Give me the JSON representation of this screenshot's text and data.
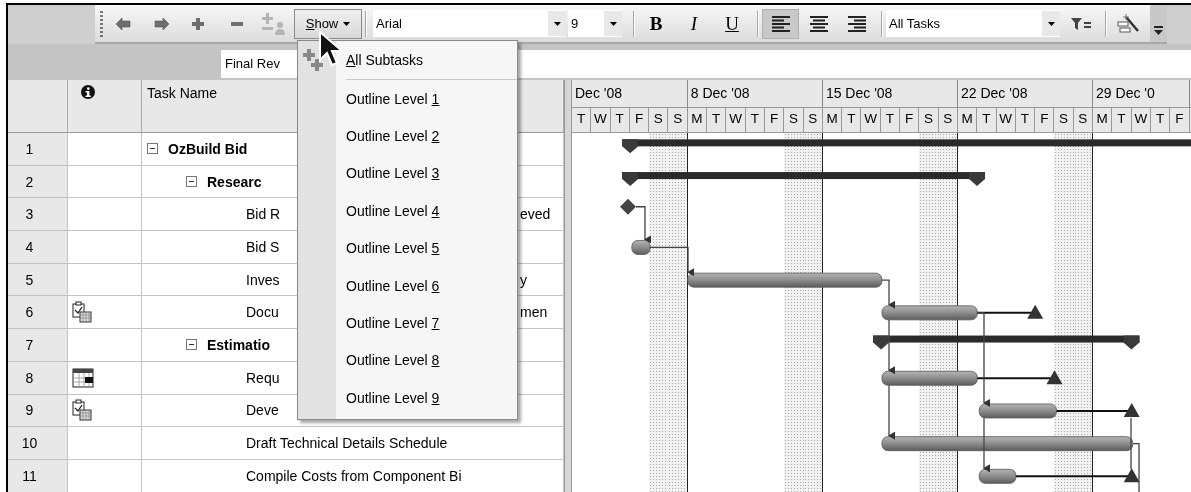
{
  "toolbar": {
    "tools": [
      {
        "kind": "outdent",
        "disabled": false
      },
      {
        "kind": "indent",
        "disabled": false
      },
      {
        "kind": "show-subtasks",
        "disabled": false
      },
      {
        "kind": "hide-subtasks",
        "disabled": false
      },
      {
        "kind": "assign",
        "disabled": true
      }
    ],
    "show_button": {
      "access_key": "S",
      "text_after": "how",
      "hovered": true
    },
    "font": {
      "value": "Arial"
    },
    "font_size": {
      "value": "9"
    },
    "format": [
      {
        "kind": "bold",
        "label": "B",
        "selected": false
      },
      {
        "kind": "italic",
        "label": "I",
        "selected": false
      },
      {
        "kind": "underline",
        "label": "U",
        "selected": false
      }
    ],
    "align": [
      {
        "kind": "left",
        "selected": true
      },
      {
        "kind": "center",
        "selected": false
      },
      {
        "kind": "right",
        "selected": false
      }
    ],
    "filter": {
      "value": "All Tasks"
    }
  },
  "entry_bar": {
    "value": "Final Rev"
  },
  "show_menu": {
    "items": [
      {
        "kind": "all",
        "access_key": "A",
        "text_after": "ll Subtasks"
      },
      {
        "kind": "level",
        "text_before": "Outline Level ",
        "access_key": "1"
      },
      {
        "kind": "level",
        "text_before": "Outline Level ",
        "access_key": "2"
      },
      {
        "kind": "level",
        "text_before": "Outline Level ",
        "access_key": "3"
      },
      {
        "kind": "level",
        "text_before": "Outline Level ",
        "access_key": "4"
      },
      {
        "kind": "level",
        "text_before": "Outline Level ",
        "access_key": "5"
      },
      {
        "kind": "level",
        "text_before": "Outline Level ",
        "access_key": "6"
      },
      {
        "kind": "level",
        "text_before": "Outline Level ",
        "access_key": "7"
      },
      {
        "kind": "level",
        "text_before": "Outline Level ",
        "access_key": "8"
      },
      {
        "kind": "level",
        "text_before": "Outline Level ",
        "access_key": "9"
      }
    ]
  },
  "columns": [
    {
      "kind": "info"
    },
    {
      "kind": "name",
      "title": "Task Name"
    }
  ],
  "tasks": [
    {
      "id": "1",
      "name": "OzBuild Bid",
      "expanded": true,
      "kind": "summary",
      "deadline": false,
      "children": [
        {
          "id": "2",
          "name": "Researc",
          "expanded": true,
          "kind": "summary",
          "deadline": false,
          "children": [
            {
              "id": "3",
              "name": "Bid R",
              "name_tail": "eved",
              "kind": "milestone",
              "deadline": false
            },
            {
              "id": "4",
              "name": "Bid S",
              "kind": "task",
              "deadline": false
            },
            {
              "id": "5",
              "name": "Inves",
              "name_tail": "y",
              "kind": "task",
              "deadline": false
            },
            {
              "id": "6",
              "name": "Docu",
              "name_tail": "men",
              "indicator": {
                "kind": "notes"
              },
              "kind": "task",
              "deadline": true
            }
          ]
        },
        {
          "id": "7",
          "name": "Estimatio",
          "expanded": true,
          "kind": "summary",
          "deadline": false,
          "children": [
            {
              "id": "8",
              "name": "Requ",
              "indicator": {
                "kind": "calendar"
              },
              "kind": "task",
              "deadline": true
            },
            {
              "id": "9",
              "name": "Deve",
              "indicator": {
                "kind": "notes"
              },
              "kind": "task",
              "deadline": true
            },
            {
              "id": "10",
              "name": "Draft Technical Details Schedule",
              "kind": "task",
              "deadline": false
            },
            {
              "id": "11",
              "name": "Compile Costs from Component Bi",
              "kind": "task",
              "deadline": true
            }
          ]
        }
      ]
    }
  ],
  "timescale": {
    "weeks": [
      {
        "label": "Dec '08",
        "days": [
          {
            "label": "T",
            "nonworking": false
          },
          {
            "label": "W",
            "nonworking": false
          },
          {
            "label": "T",
            "nonworking": false
          },
          {
            "label": "F",
            "nonworking": false
          },
          {
            "label": "S",
            "nonworking": true
          },
          {
            "label": "S",
            "nonworking": true
          }
        ]
      },
      {
        "label": "8 Dec '08",
        "days": [
          {
            "label": "M",
            "nonworking": false
          },
          {
            "label": "T",
            "nonworking": false
          },
          {
            "label": "W",
            "nonworking": false
          },
          {
            "label": "T",
            "nonworking": false
          },
          {
            "label": "F",
            "nonworking": false
          },
          {
            "label": "S",
            "nonworking": true
          },
          {
            "label": "S",
            "nonworking": true
          }
        ]
      },
      {
        "label": "15 Dec '08",
        "days": [
          {
            "label": "M",
            "nonworking": false
          },
          {
            "label": "T",
            "nonworking": false
          },
          {
            "label": "W",
            "nonworking": false
          },
          {
            "label": "T",
            "nonworking": false
          },
          {
            "label": "F",
            "nonworking": false
          },
          {
            "label": "S",
            "nonworking": true
          },
          {
            "label": "S",
            "nonworking": true
          }
        ]
      },
      {
        "label": "22 Dec '08",
        "days": [
          {
            "label": "M",
            "nonworking": false
          },
          {
            "label": "T",
            "nonworking": false
          },
          {
            "label": "W",
            "nonworking": false
          },
          {
            "label": "T",
            "nonworking": false
          },
          {
            "label": "F",
            "nonworking": false
          },
          {
            "label": "S",
            "nonworking": true
          },
          {
            "label": "S",
            "nonworking": true
          }
        ]
      },
      {
        "label": "29 Dec '0",
        "days": [
          {
            "label": "M",
            "nonworking": false
          },
          {
            "label": "T",
            "nonworking": false
          },
          {
            "label": "W",
            "nonworking": false
          },
          {
            "label": "T",
            "nonworking": false
          },
          {
            "label": "F",
            "nonworking": false
          }
        ]
      }
    ]
  }
}
